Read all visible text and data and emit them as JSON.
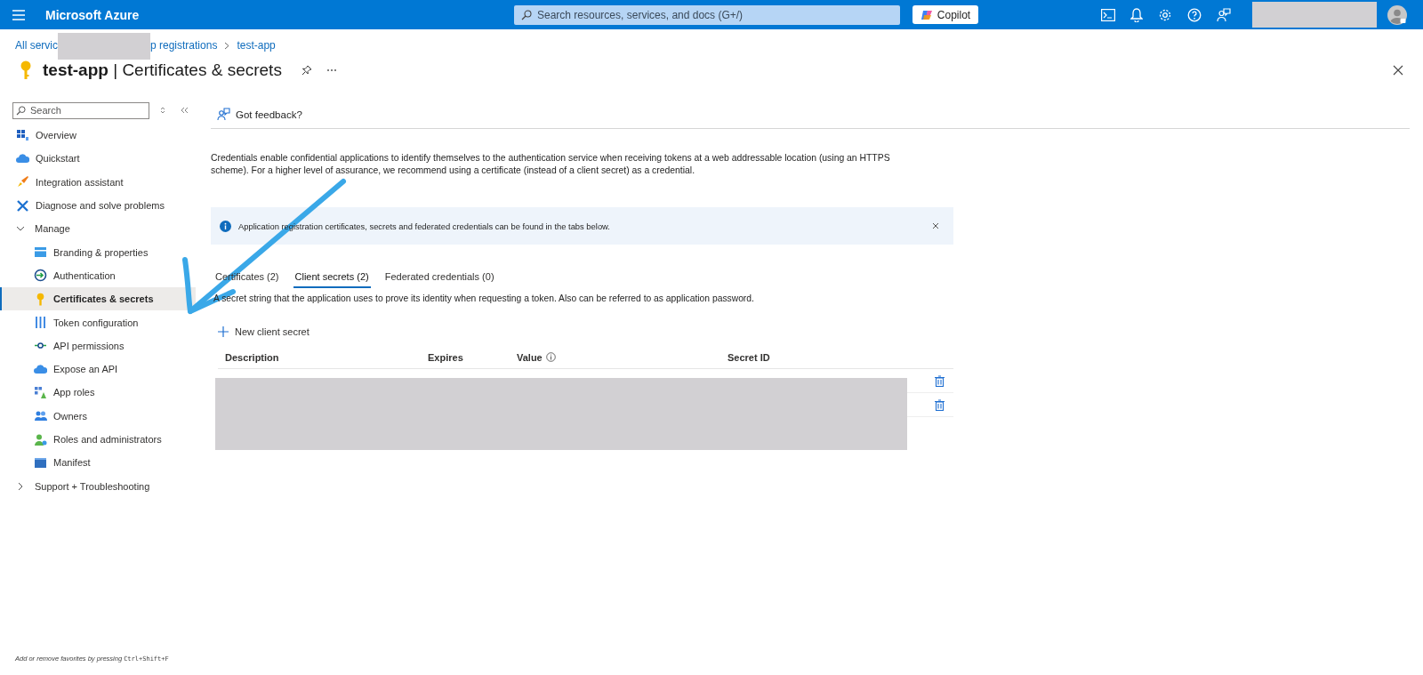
{
  "topbar": {
    "brand": "Microsoft Azure",
    "search": {
      "placeholder": "Search resources, services, and docs (G+/)"
    },
    "copilot": "Copilot",
    "account": {
      "redacted": true
    }
  },
  "breadcrumb": {
    "redacted": true,
    "items": [
      "All servic",
      "p registrations",
      "test-app"
    ]
  },
  "page": {
    "title": "**test-app** | Certificates & secrets"
  },
  "sidebar": {
    "search": {
      "placeholder": "Search"
    },
    "items": [
      {
        "label": "Overview",
        "selected": false
      },
      {
        "label": "Quickstart",
        "selected": false
      },
      {
        "label": "Integration assistant",
        "selected": false
      },
      {
        "label": "Diagnose and solve problems",
        "selected": false
      },
      {
        "label": "Manage",
        "expanded": true,
        "selected": false,
        "children": [
          {
            "label": "Branding & properties",
            "selected": false
          },
          {
            "label": "Authentication",
            "selected": false
          },
          {
            "label": "Certificates & secrets",
            "selected": true
          },
          {
            "label": "Token configuration",
            "selected": false
          },
          {
            "label": "API permissions",
            "selected": false
          },
          {
            "label": "Expose an API",
            "selected": false
          },
          {
            "label": "App roles",
            "selected": false
          },
          {
            "label": "Owners",
            "selected": false
          },
          {
            "label": "Roles and administrators",
            "selected": false
          },
          {
            "label": "Manifest",
            "selected": false
          }
        ]
      },
      {
        "label": "Support + Troubleshooting",
        "expanded": false,
        "selected": false
      }
    ],
    "footer": "Add or remove favorites by pressing ",
    "shortcut": "Ctrl+Shift+F"
  },
  "content": {
    "feedback": "Got feedback?",
    "intro": "Credentials enable confidential applications to identify themselves to the authentication service when receiving tokens at a web addressable location (using an HTTPS scheme). For a higher level of assurance, we recommend using a certificate (instead of a client secret) as a credential.",
    "banner": "Application registration certificates, secrets and federated credentials can be found in the tabs below.",
    "tabs": [
      {
        "label": "Certificates (2)",
        "selected": false
      },
      {
        "label": "Client secrets (2)",
        "selected": true
      },
      {
        "label": "Federated credentials (0)",
        "selected": false
      }
    ],
    "tab_description": "A secret string that the application uses to prove its identity when requesting a token. Also can be referred to as application password.",
    "new_button": "New client secret",
    "table": {
      "columns": [
        "Description",
        "Expires",
        "Value",
        "Secret ID"
      ],
      "redacted": true,
      "rows": [
        {
          "deletable": true
        },
        {
          "deletable": true
        }
      ]
    }
  },
  "annotation": {
    "kind": "arrow",
    "color": "#3aa8e8"
  }
}
